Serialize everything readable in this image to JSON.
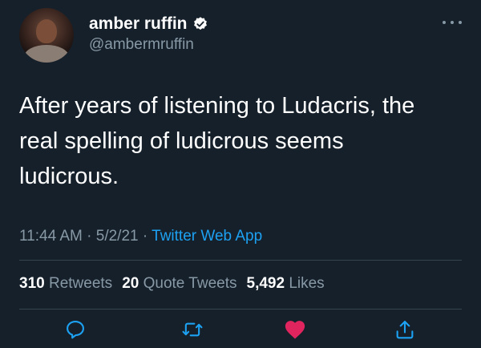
{
  "user": {
    "display_name": "amber ruffin",
    "handle": "@ambermruffin",
    "verified": true,
    "avatar_icon": "avatar-photo"
  },
  "tweet": {
    "text": "After years of listening to Ludacris, the\nreal spelling of ludicrous seems\nludicrous."
  },
  "meta": {
    "time": "11:44 AM",
    "sep1": " · ",
    "date": "5/2/21",
    "sep2": " · ",
    "source": "Twitter Web App"
  },
  "stats": {
    "retweets_count": "310",
    "retweets_label": "Retweets",
    "quotes_count": "20",
    "quotes_label": "Quote Tweets",
    "likes_count": "5,492",
    "likes_label": "Likes"
  },
  "actions": [
    {
      "name": "reply",
      "icon": "reply-icon"
    },
    {
      "name": "retweet",
      "icon": "retweet-icon"
    },
    {
      "name": "like",
      "icon": "heart-icon",
      "active": true
    },
    {
      "name": "share",
      "icon": "share-icon"
    }
  ],
  "colors": {
    "background": "#15202b",
    "secondary_text": "#8899a6",
    "accent": "#1da1f2",
    "like": "#e0245e",
    "divider": "#38444d"
  }
}
